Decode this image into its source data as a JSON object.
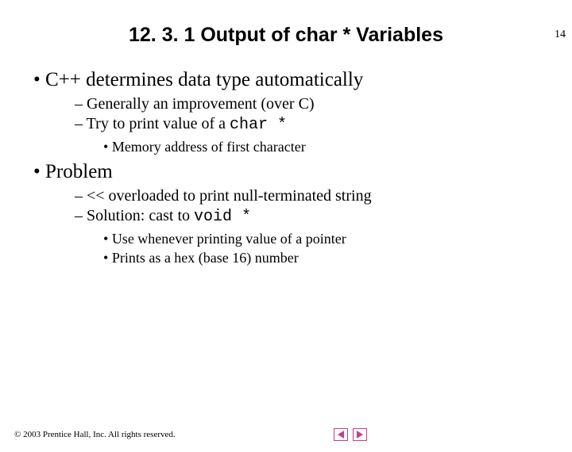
{
  "page_number": "14",
  "title": "12. 3. 1 Output of char * Variables",
  "bullets": [
    {
      "text": "C++ determines data type automatically",
      "sub": [
        {
          "text": "Generally an improvement (over C)"
        },
        {
          "text_prefix": "Try to print value of a ",
          "code": "char *",
          "sub": [
            {
              "text": "Memory address of first character"
            }
          ]
        }
      ]
    },
    {
      "text": "Problem",
      "sub": [
        {
          "text": "<< overloaded to print null-terminated string"
        },
        {
          "text_prefix": "Solution: cast to ",
          "code": "void *",
          "sub": [
            {
              "text": "Use whenever printing value of a pointer"
            },
            {
              "text": "Prints as a hex (base 16) number"
            }
          ]
        }
      ]
    }
  ],
  "copyright": "© 2003 Prentice Hall, Inc. All rights reserved."
}
